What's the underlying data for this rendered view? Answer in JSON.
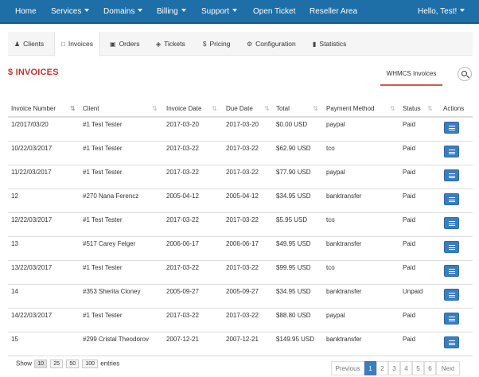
{
  "nav": {
    "items": [
      "Home",
      "Services",
      "Domains",
      "Billing",
      "Support",
      "Open Ticket",
      "Reseller Area"
    ],
    "user": "Hello, Test!"
  },
  "subnav": {
    "tabs": [
      "Clients",
      "Invoices",
      "Orders",
      "Tickets",
      "Pricing",
      "Configuration",
      "Statistics"
    ]
  },
  "page": {
    "title": "$ INVOICES",
    "whmcs_tab": "WHMCS Invoices"
  },
  "table": {
    "headers": [
      "Invoice Number",
      "Client",
      "Invoice Date",
      "Due Date",
      "Total",
      "Payment Method",
      "Status",
      "Actions"
    ],
    "rows": [
      [
        "1/2017/03/20",
        "#1 Test Tester",
        "2017-03-20",
        "2017-03-20",
        "$0.00 USD",
        "paypal",
        "Paid"
      ],
      [
        "10/22/03/2017",
        "#1 Test Tester",
        "2017-03-22",
        "2017-03-22",
        "$62.90 USD",
        "tco",
        "Paid"
      ],
      [
        "11/22/03/2017",
        "#1 Test Tester",
        "2017-03-22",
        "2017-03-22",
        "$77.90 USD",
        "paypal",
        "Paid"
      ],
      [
        "12",
        "#270 Nana Ferencz",
        "2005-04-12",
        "2005-04-12",
        "$34.95 USD",
        "banktransfer",
        "Paid"
      ],
      [
        "12/22/03/2017",
        "#1 Test Tester",
        "2017-03-22",
        "2017-03-22",
        "$5.95 USD",
        "tco",
        "Paid"
      ],
      [
        "13",
        "#517 Carey Felger",
        "2006-06-17",
        "2006-06-17",
        "$49.95 USD",
        "banktransfer",
        "Paid"
      ],
      [
        "13/22/03/2017",
        "#1 Test Tester",
        "2017-03-22",
        "2017-03-22",
        "$99.95 USD",
        "tco",
        "Paid"
      ],
      [
        "14",
        "#353 Sherita Cloney",
        "2005-09-27",
        "2005-09-27",
        "$34.95 USD",
        "banktransfer",
        "Unpaid"
      ],
      [
        "14/22/03/2017",
        "#1 Test Tester",
        "2017-03-22",
        "2017-03-22",
        "$88.80 USD",
        "paypal",
        "Paid"
      ],
      [
        "15",
        "#299 Cristal Theodorov",
        "2007-12-21",
        "2007-12-21",
        "$149.95 USD",
        "banktransfer",
        "Paid"
      ]
    ]
  },
  "footer": {
    "show_label": "Show",
    "page_sizes": [
      "10",
      "25",
      "50",
      "100"
    ],
    "entries_label": "entries",
    "pagination": [
      "Previous",
      "1",
      "2",
      "3",
      "4",
      "5",
      "6",
      "Next"
    ],
    "current_page": "1"
  },
  "colors": {
    "nav_bg": "#1e6fa8",
    "title_red": "#c9302c",
    "tab_underline": "#d9534f",
    "button_blue": "#3a7ec2"
  },
  "icons": {
    "clients": "users-icon",
    "invoices": "file-icon",
    "orders": "cart-icon",
    "tickets": "tag-icon",
    "pricing": "dollar-icon",
    "configuration": "cogs-icon",
    "statistics": "bar-chart-icon",
    "search": "search-icon",
    "action": "list-icon"
  }
}
